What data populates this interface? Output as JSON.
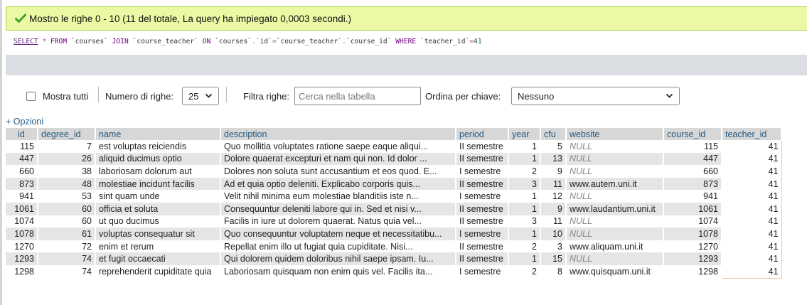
{
  "banner": {
    "message": "Mostro le righe 0 - 10 (11 del totale, La query ha impiegato 0,0003 secondi.)"
  },
  "sql": {
    "select": "SELECT",
    "star": "*",
    "from": "FROM",
    "t1": "`courses`",
    "join": "JOIN",
    "t2": "`course_teacher`",
    "on": "ON",
    "c1": "`courses`",
    "dot1": ".",
    "c1b": "`id`",
    "eq": "=",
    "c2": "`course_teacher`",
    "dot2": ".",
    "c2b": "`course_id`",
    "where": "WHERE",
    "c3": "`teacher_id`",
    "eq2": "=",
    "val": "41"
  },
  "controls": {
    "show_all_label": "Mostra tutti",
    "rows_label": "Numero di righe:",
    "rows_value": "25",
    "filter_label": "Filtra righe:",
    "filter_placeholder": "Cerca nella tabella",
    "sort_label": "Ordina per chiave:",
    "sort_value": "Nessuno"
  },
  "options_link": "+ Opzioni",
  "table": {
    "columns": [
      "id",
      "degree_id",
      "name",
      "description",
      "period",
      "year",
      "cfu",
      "website",
      "course_id",
      "teacher_id"
    ],
    "rows": [
      [
        "115",
        "7",
        "est voluptas reiciendis",
        "Quo mollitia voluptates ratione saepe eaque aliqui...",
        "II semestre",
        "1",
        "5",
        "NULL",
        "115",
        "41"
      ],
      [
        "447",
        "26",
        "aliquid ducimus optio",
        "Dolore quaerat excepturi et nam qui non. Id dolor ...",
        "II semestre",
        "1",
        "13",
        "NULL",
        "447",
        "41"
      ],
      [
        "660",
        "38",
        "laboriosam dolorum aut",
        "Dolores non soluta sunt accusantium et eos quod. E...",
        "I semestre",
        "2",
        "9",
        "NULL",
        "660",
        "41"
      ],
      [
        "873",
        "48",
        "molestiae incidunt facilis",
        "Ad et quia optio deleniti. Explicabo corporis quis...",
        "II semestre",
        "3",
        "11",
        "www.autem.uni.it",
        "873",
        "41"
      ],
      [
        "941",
        "53",
        "sint quam unde",
        "Velit nihil minima eum molestiae blanditiis iste n...",
        "I semestre",
        "1",
        "12",
        "NULL",
        "941",
        "41"
      ],
      [
        "1061",
        "60",
        "officia et soluta",
        "Consequuntur deleniti labore qui in. Sed et nisi v...",
        "II semestre",
        "1",
        "9",
        "www.laudantium.uni.it",
        "1061",
        "41"
      ],
      [
        "1074",
        "60",
        "ut quo ducimus",
        "Facilis in iure ut dolorem quaerat. Natus quia vel...",
        "II semestre",
        "3",
        "11",
        "NULL",
        "1074",
        "41"
      ],
      [
        "1078",
        "61",
        "voluptas consequatur sit",
        "Quo consequuntur voluptatem neque et necessitatibu...",
        "I semestre",
        "1",
        "10",
        "NULL",
        "1078",
        "41"
      ],
      [
        "1270",
        "72",
        "enim et rerum",
        "Repellat enim illo ut fugiat quia cupiditate. Nisi...",
        "II semestre",
        "2",
        "3",
        "www.aliquam.uni.it",
        "1270",
        "41"
      ],
      [
        "1293",
        "74",
        "et fugit occaecati",
        "Qui dolorem quidem doloribus nihil saepe ipsam. Iu...",
        "II semestre",
        "1",
        "15",
        "NULL",
        "1293",
        "41"
      ],
      [
        "1298",
        "74",
        "reprehenderit cupiditate quia",
        "Laboriosam quisquam non enim quis vel. Facilis ita...",
        "I semestre",
        "2",
        "8",
        "www.quisquam.uni.it",
        "1298",
        "41"
      ]
    ]
  },
  "colors": {
    "success_bg": "#ebf8a4",
    "success_border": "#a2d246",
    "header_bg": "#d7d7d7",
    "header_text": "#235a81",
    "row_alt": "#e5e5e5"
  }
}
